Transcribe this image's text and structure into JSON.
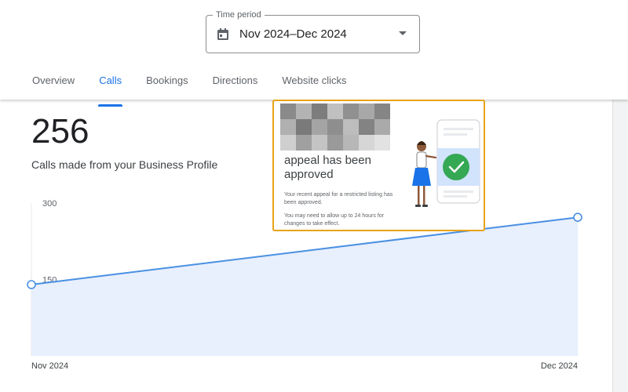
{
  "time_period": {
    "legend": "Time period",
    "value": "Nov 2024–Dec 2024",
    "icons": {
      "calendar": "calendar-icon",
      "dropdown": "caret-down-icon"
    }
  },
  "tabs": [
    {
      "label": "Overview",
      "active": false
    },
    {
      "label": "Calls",
      "active": true
    },
    {
      "label": "Bookings",
      "active": false
    },
    {
      "label": "Directions",
      "active": false
    },
    {
      "label": "Website clicks",
      "active": false
    }
  ],
  "summary": {
    "total": "256",
    "caption": "Calls made from your Business Profile"
  },
  "card": {
    "heading": "appeal has been approved",
    "body1": "Your recent appeal for a restricted listing has been approved.",
    "body2": "You may need to allow up to 24 hours for changes to take effect."
  },
  "colors": {
    "accent": "#1a73e8",
    "line": "#4a90e2",
    "area": "#e8effd",
    "highlight_border": "#e8a317",
    "success": "#34a853"
  },
  "chart_data": {
    "type": "area",
    "x": [
      "Nov 2024",
      "Dec 2024"
    ],
    "values": [
      140,
      272
    ],
    "y_ticks": [
      "150",
      "300"
    ],
    "ylim": [
      0,
      300
    ]
  }
}
